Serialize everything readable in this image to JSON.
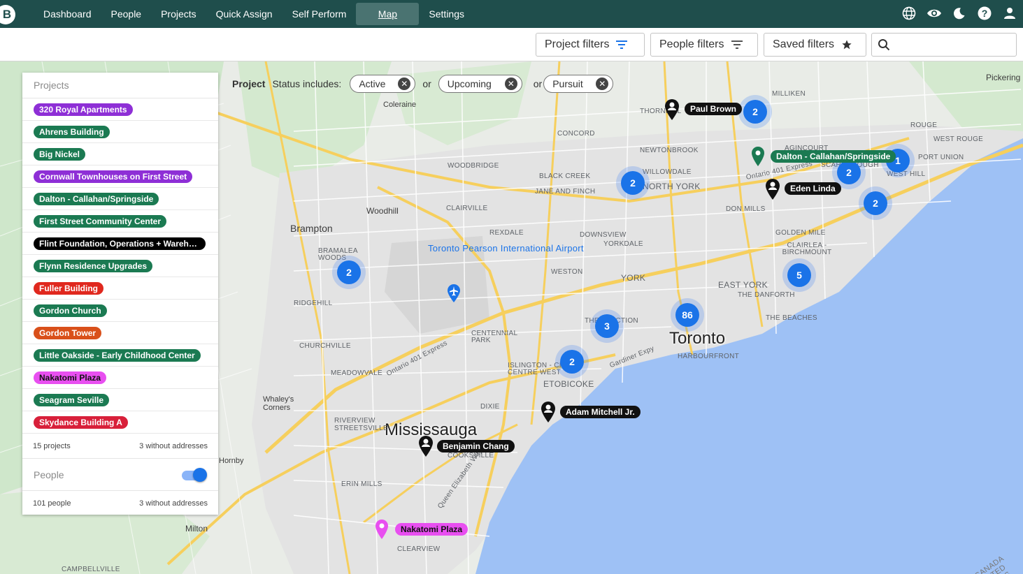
{
  "nav": {
    "logo": "B",
    "items": [
      {
        "label": "Dashboard"
      },
      {
        "label": "People"
      },
      {
        "label": "Projects"
      },
      {
        "label": "Quick Assign"
      },
      {
        "label": "Self Perform"
      },
      {
        "label": "Map",
        "active": true
      },
      {
        "label": "Settings"
      }
    ],
    "icons": [
      "globe-icon",
      "eye-icon",
      "moon-icon",
      "help-icon",
      "user-icon"
    ]
  },
  "filters": {
    "project_filters": "Project filters",
    "people_filters": "People filters",
    "saved_filters": "Saved filters",
    "search_placeholder": ""
  },
  "status_bar": {
    "label": "Project",
    "prefix": "Status includes:",
    "joiner": "or",
    "chips": [
      "Active",
      "Upcoming",
      "Pursuit"
    ]
  },
  "panel": {
    "projects_heading": "Projects",
    "projects": [
      {
        "name": "320 Royal Apartments",
        "color": "#8e2fd6"
      },
      {
        "name": "Ahrens Building",
        "color": "#1b7a52"
      },
      {
        "name": "Big Nickel",
        "color": "#1b7a52"
      },
      {
        "name": "Cornwall Townhouses on First Street",
        "color": "#8e2fd6"
      },
      {
        "name": "Dalton - Callahan/Springside",
        "color": "#1b7a52"
      },
      {
        "name": "First Street Community Center",
        "color": "#1b7a52"
      },
      {
        "name": "Flint Foundation, Operations + Warehouse",
        "color": "#000000"
      },
      {
        "name": "Flynn Residence Upgrades",
        "color": "#1b7a52"
      },
      {
        "name": "Fuller Building",
        "color": "#e0281e"
      },
      {
        "name": "Gordon Church",
        "color": "#1b7a52"
      },
      {
        "name": "Gordon Tower",
        "color": "#d9501a"
      },
      {
        "name": "Little Oakside - Early Childhood Center",
        "color": "#1b7a52"
      },
      {
        "name": "Nakatomi Plaza",
        "color": "#e84ff0",
        "text_color": "#111111"
      },
      {
        "name": "Seagram Seville",
        "color": "#1b7a52"
      },
      {
        "name": "Skydance Building A",
        "color": "#d8203a"
      }
    ],
    "projects_count": "15 projects",
    "projects_without": "3 without addresses",
    "people_heading": "People",
    "people_toggle_on": true,
    "people_count": "101 people",
    "people_without": "3 without addresses"
  },
  "map": {
    "clusters": [
      "2",
      "2",
      "2",
      "2",
      "5",
      "86",
      "3",
      "2",
      "2",
      "1"
    ],
    "people_pins": [
      "Paul Brown",
      "Eden Linda",
      "Adam Mitchell Jr.",
      "Benjamin Chang"
    ],
    "project_pins": [
      {
        "name": "Dalton - Callahan/Springside",
        "color": "#1b7a52"
      },
      {
        "name": "Nakatomi Plaza",
        "color": "#e84ff0"
      }
    ],
    "big_labels": [
      "Toronto",
      "Mississauga"
    ],
    "city_labels": [
      "Brampton",
      "Woodhill",
      "Coleraine",
      "Milton",
      "Hornby",
      "Whaley's Corners",
      "Pickering"
    ],
    "area_labels": [
      "NORTH YORK",
      "YORK",
      "EAST YORK",
      "ETOBICOKE",
      "SCARBOROUGH",
      "WEST HILL",
      "PORT UNION",
      "WEST ROUGE",
      "ROUGE",
      "MILLIKEN",
      "AGINCOURT",
      "THORNHILL",
      "CONCORD",
      "NEWTONBROOK",
      "WILLOWDALE",
      "BLACK CREEK",
      "JANE AND FINCH",
      "DOWNSVIEW",
      "YORKDALE",
      "WESTON",
      "DON MILLS",
      "GOLDEN MILE",
      "CLAIRLEA - BIRCHMOUNT",
      "THE DANFORTH",
      "THE BEACHES",
      "HARBOURFRONT",
      "CENTENNIAL PARK",
      "ISLINGTON - CITY CENTRE WEST",
      "WOODBRIDGE",
      "CLAIRVILLE",
      "REXDALE",
      "BRAMALEA WOODS",
      "RIDGEHILL",
      "CHURCHVILLE",
      "MEADOWVALE",
      "DIXIE",
      "RIVERVIEW STREETSVILLE",
      "COOKSVILLE",
      "ERIN MILLS",
      "CLEARVIEW",
      "CAMPBELLVILLE",
      "THE JUNCTION"
    ],
    "airport_label": "Toronto Pearson International Airport",
    "highway_labels": [
      "Ontario 401 Express",
      "Gardiner Expy",
      "Queen Elizabeth Way"
    ],
    "border_label": "CANADA UNITED STATES"
  }
}
